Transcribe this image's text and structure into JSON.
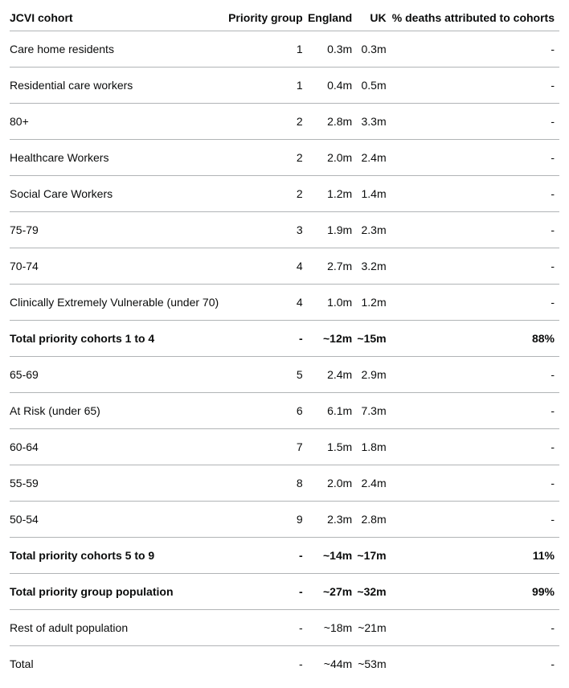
{
  "headers": {
    "cohort": "JCVI cohort",
    "priority": "Priority group",
    "england": "England",
    "uk": "UK",
    "deaths": "% deaths attributed to cohorts"
  },
  "rows": [
    {
      "cohort": "Care home residents",
      "priority": "1",
      "england": "0.3m",
      "uk": "0.3m",
      "deaths": "-",
      "bold": false
    },
    {
      "cohort": "Residential care workers",
      "priority": "1",
      "england": "0.4m",
      "uk": "0.5m",
      "deaths": "-",
      "bold": false
    },
    {
      "cohort": "80+",
      "priority": "2",
      "england": "2.8m",
      "uk": "3.3m",
      "deaths": "-",
      "bold": false
    },
    {
      "cohort": "Healthcare Workers",
      "priority": "2",
      "england": "2.0m",
      "uk": "2.4m",
      "deaths": "-",
      "bold": false
    },
    {
      "cohort": "Social Care Workers",
      "priority": "2",
      "england": "1.2m",
      "uk": "1.4m",
      "deaths": "-",
      "bold": false
    },
    {
      "cohort": "75-79",
      "priority": "3",
      "england": "1.9m",
      "uk": "2.3m",
      "deaths": "-",
      "bold": false
    },
    {
      "cohort": "70-74",
      "priority": "4",
      "england": "2.7m",
      "uk": "3.2m",
      "deaths": "-",
      "bold": false
    },
    {
      "cohort": "Clinically Extremely Vulnerable (under 70)",
      "priority": "4",
      "england": "1.0m",
      "uk": "1.2m",
      "deaths": "-",
      "bold": false
    },
    {
      "cohort": "Total priority cohorts 1 to 4",
      "priority": "-",
      "england": "~12m",
      "uk": "~15m",
      "deaths": "88%",
      "bold": true
    },
    {
      "cohort": "65-69",
      "priority": "5",
      "england": "2.4m",
      "uk": "2.9m",
      "deaths": "-",
      "bold": false
    },
    {
      "cohort": "At Risk (under 65)",
      "priority": "6",
      "england": "6.1m",
      "uk": "7.3m",
      "deaths": "-",
      "bold": false
    },
    {
      "cohort": "60-64",
      "priority": "7",
      "england": "1.5m",
      "uk": "1.8m",
      "deaths": "-",
      "bold": false
    },
    {
      "cohort": "55-59",
      "priority": "8",
      "england": "2.0m",
      "uk": "2.4m",
      "deaths": "-",
      "bold": false
    },
    {
      "cohort": "50-54",
      "priority": "9",
      "england": "2.3m",
      "uk": "2.8m",
      "deaths": "-",
      "bold": false
    },
    {
      "cohort": "Total priority cohorts 5 to 9",
      "priority": "-",
      "england": "~14m",
      "uk": "~17m",
      "deaths": "11%",
      "bold": true
    },
    {
      "cohort": "Total priority group population",
      "priority": "-",
      "england": "~27m",
      "uk": "~32m",
      "deaths": "99%",
      "bold": true
    },
    {
      "cohort": "Rest of adult population",
      "priority": "-",
      "england": "~18m",
      "uk": "~21m",
      "deaths": "-",
      "bold": false
    },
    {
      "cohort": "Total",
      "priority": "-",
      "england": "~44m",
      "uk": "~53m",
      "deaths": "-",
      "bold": false
    }
  ]
}
